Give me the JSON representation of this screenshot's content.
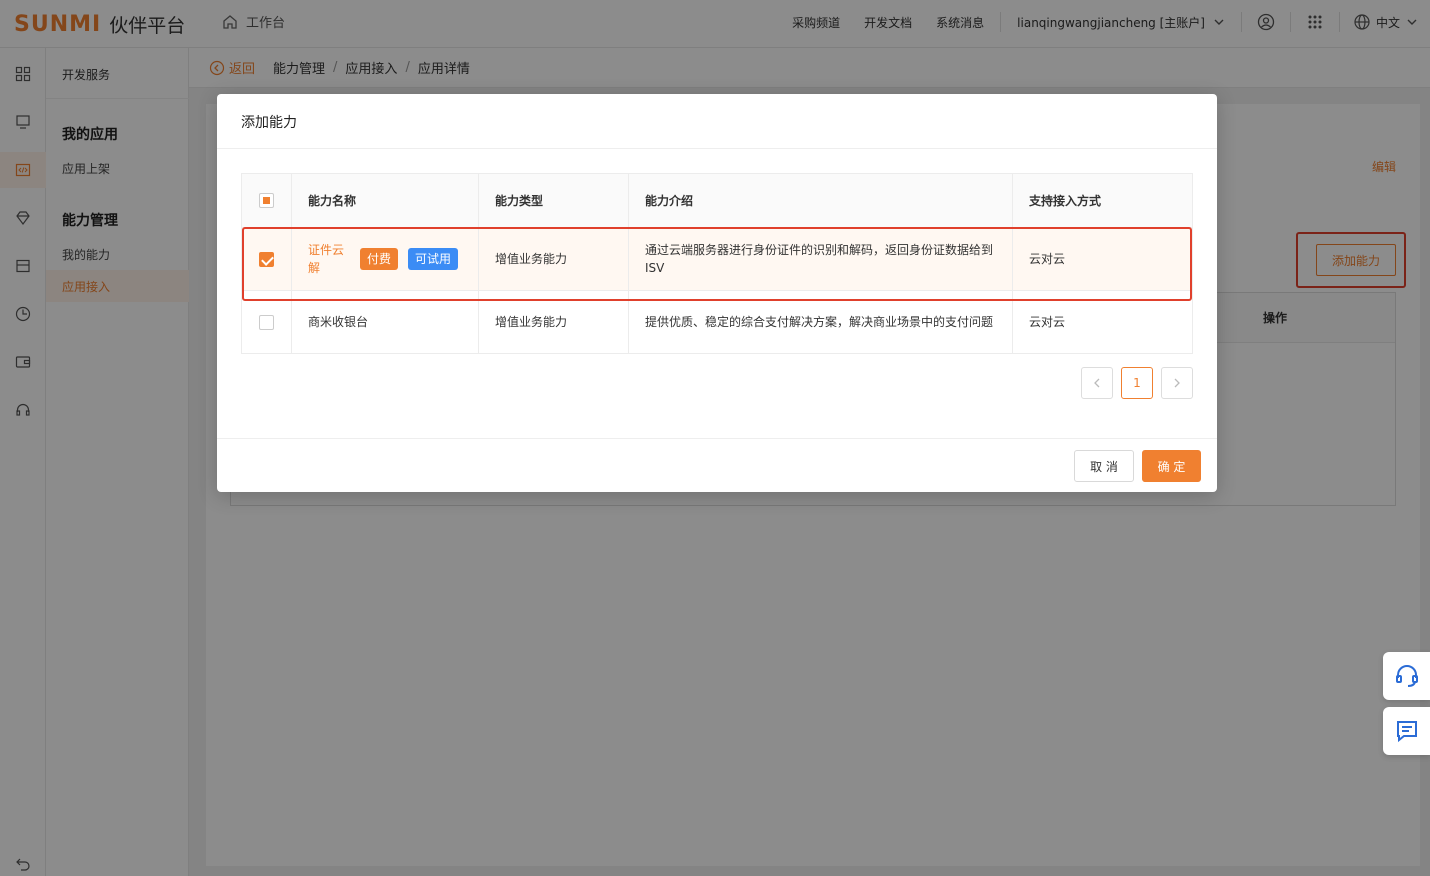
{
  "header": {
    "logo_mark": "SUNMI",
    "logo_title": "伙伴平台",
    "workbench": "工作台",
    "links": [
      "采购频道",
      "开发文档",
      "系统消息"
    ],
    "account": "lianqingwangjiancheng [主账户]",
    "language": "中文"
  },
  "subnav": {
    "head": "开发服务",
    "group1": "我的应用",
    "item_publish": "应用上架",
    "group2": "能力管理",
    "item_my_caps": "我的能力",
    "item_integration": "应用接入"
  },
  "breadcrumb": {
    "back": "返回",
    "items": [
      "能力管理",
      "应用接入",
      "应用详情"
    ]
  },
  "page": {
    "edit": "编辑",
    "add_capability": "添加能力",
    "col_operation": "操作"
  },
  "modal": {
    "title": "添加能力",
    "columns": [
      "能力名称",
      "能力类型",
      "能力介绍",
      "支持接入方式"
    ],
    "rows": [
      {
        "name": "证件云解",
        "tags": [
          "付费",
          "可试用"
        ],
        "type": "增值业务能力",
        "intro": "通过云端服务器进行身份证件的识别和解码，返回身份证数据给到ISV",
        "access": "云对云",
        "checked": true
      },
      {
        "name": "商米收银台",
        "tags": [],
        "type": "增值业务能力",
        "intro": "提供优质、稳定的综合支付解决方案，解决商业场景中的支付问题",
        "access": "云对云",
        "checked": false
      }
    ],
    "current_page": "1",
    "cancel": "取 消",
    "confirm": "确 定"
  },
  "colors": {
    "accent": "#f08030",
    "trial_tag": "#3b8cf5",
    "annotation_red": "#e0402c"
  }
}
